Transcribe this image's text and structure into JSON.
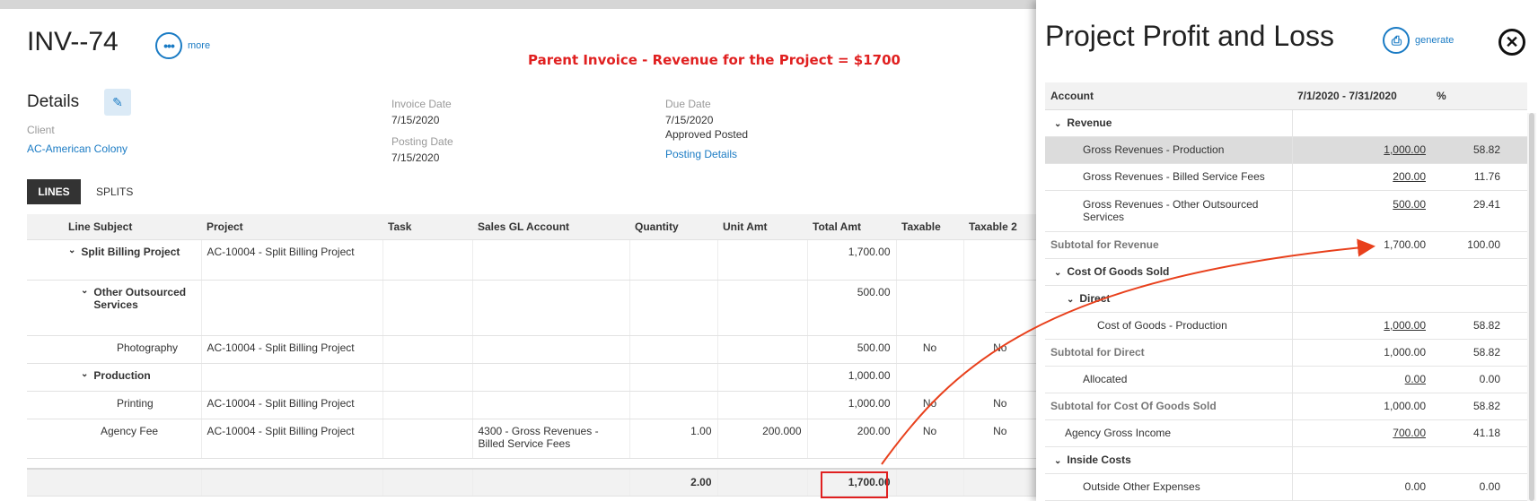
{
  "invoice": {
    "title": "INV--74",
    "more_label": "more",
    "note": "Parent Invoice  - Revenue for the Project = $1700",
    "details_heading": "Details",
    "client_label": "Client",
    "client_value": "AC-American Colony",
    "invoice_date_label": "Invoice Date",
    "invoice_date": "7/15/2020",
    "posting_date_label": "Posting Date",
    "posting_date": "7/15/2020",
    "due_date_label": "Due Date",
    "due_date": "7/15/2020",
    "status": "Approved Posted",
    "posting_details_link": "Posting Details",
    "tabs": [
      "LINES",
      "SPLITS"
    ],
    "columns": [
      "Line Subject",
      "Project",
      "Task",
      "Sales GL Account",
      "Quantity",
      "Unit Amt",
      "Total Amt",
      "Taxable",
      "Taxable 2"
    ],
    "rows": [
      {
        "subject": "Split Billing Project",
        "project": "AC-10004 - Split Billing Project",
        "task": "",
        "gl": "",
        "qty": "",
        "unit": "",
        "total": "1,700.00",
        "taxable": "",
        "taxable2": ""
      },
      {
        "subject": "Other Outsourced Services",
        "project": "",
        "task": "",
        "gl": "",
        "qty": "",
        "unit": "",
        "total": "500.00",
        "taxable": "",
        "taxable2": ""
      },
      {
        "subject": "Photography",
        "project": "AC-10004 - Split Billing Project",
        "task": "",
        "gl": "",
        "qty": "",
        "unit": "",
        "total": "500.00",
        "taxable": "No",
        "taxable2": "No"
      },
      {
        "subject": "Production",
        "project": "",
        "task": "",
        "gl": "",
        "qty": "",
        "unit": "",
        "total": "1,000.00",
        "taxable": "",
        "taxable2": ""
      },
      {
        "subject": "Printing",
        "project": "AC-10004 - Split Billing Project",
        "task": "",
        "gl": "",
        "qty": "",
        "unit": "",
        "total": "1,000.00",
        "taxable": "No",
        "taxable2": "No"
      },
      {
        "subject": "Agency Fee",
        "project": "AC-10004 - Split Billing Project",
        "task": "",
        "gl": "4300 - Gross Revenues - Billed Service Fees",
        "qty": "1.00",
        "unit": "200.000",
        "total": "200.00",
        "taxable": "No",
        "taxable2": "No"
      }
    ],
    "totals": {
      "qty": "2.00",
      "total": "1,700.00"
    }
  },
  "pl": {
    "title": "Project Profit and Loss",
    "generate_label": "generate",
    "columns": [
      "Account",
      "7/1/2020 - 7/31/2020",
      "%"
    ],
    "rows": [
      {
        "account": "Revenue",
        "amount": "",
        "pct": ""
      },
      {
        "account": "Gross Revenues - Production",
        "amount": "1,000.00",
        "pct": "58.82"
      },
      {
        "account": "Gross Revenues - Billed Service Fees",
        "amount": "200.00",
        "pct": "11.76"
      },
      {
        "account": "Gross Revenues - Other Outsourced Services",
        "amount": "500.00",
        "pct": "29.41"
      },
      {
        "account": "Subtotal for Revenue",
        "amount": "1,700.00",
        "pct": "100.00"
      },
      {
        "account": "Cost Of Goods Sold",
        "amount": "",
        "pct": ""
      },
      {
        "account": "Direct",
        "amount": "",
        "pct": ""
      },
      {
        "account": "Cost of Goods - Production",
        "amount": "1,000.00",
        "pct": "58.82"
      },
      {
        "account": "Subtotal for Direct",
        "amount": "1,000.00",
        "pct": "58.82"
      },
      {
        "account": "Allocated",
        "amount": "0.00",
        "pct": "0.00"
      },
      {
        "account": "Subtotal for Cost Of Goods Sold",
        "amount": "1,000.00",
        "pct": "58.82"
      },
      {
        "account": "Agency Gross Income",
        "amount": "700.00",
        "pct": "41.18"
      },
      {
        "account": "Inside Costs",
        "amount": "",
        "pct": ""
      },
      {
        "account": "Outside Other Expenses",
        "amount": "0.00",
        "pct": "0.00"
      }
    ]
  },
  "icons": {
    "more": "ellipsis-icon",
    "edit": "pencil-icon",
    "generate": "printer-icon",
    "close": "close-icon",
    "expand": "chevron-down-icon"
  },
  "colors": {
    "accent": "#1a7bc4",
    "annotation": "#e02020"
  }
}
